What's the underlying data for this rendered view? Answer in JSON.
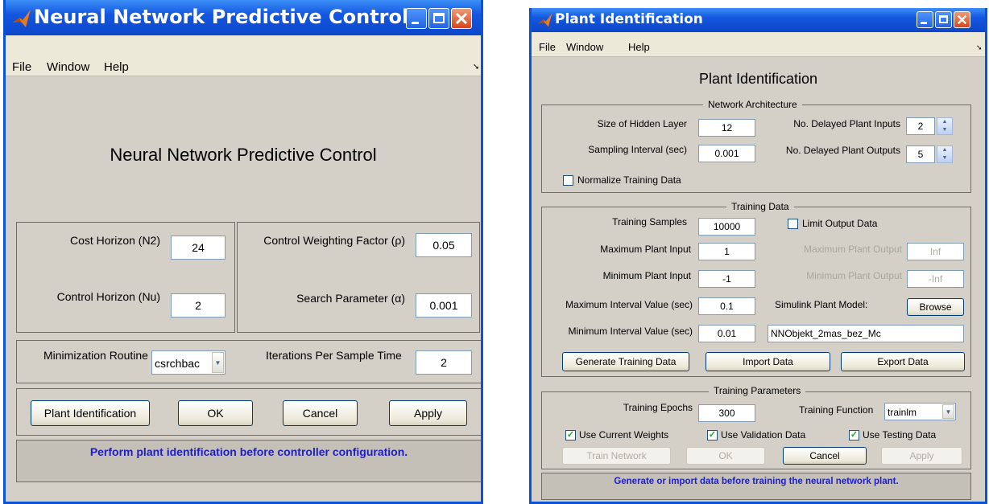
{
  "left_window": {
    "title": "Neural Network Predictive Control",
    "menu": [
      "File",
      "Window",
      "Help"
    ],
    "menu_arrow": "➘",
    "heading": "Neural Network Predictive Control",
    "cost_horizon": {
      "label": "Cost Horizon (N2)",
      "value": "24"
    },
    "control_horizon": {
      "label": "Control Horizon (Nu)",
      "value": "2"
    },
    "control_weighting": {
      "label": "Control Weighting Factor (ρ)",
      "value": "0.05"
    },
    "search_parameter": {
      "label": "Search Parameter (α)",
      "value": "0.001"
    },
    "minimization_routine": {
      "label": "Minimization Routine",
      "value": "csrchbac"
    },
    "iterations": {
      "label": "Iterations Per Sample Time",
      "value": "2"
    },
    "buttons": {
      "plant_identification": "Plant Identification",
      "ok": "OK",
      "cancel": "Cancel",
      "apply": "Apply"
    },
    "status": "Perform plant identification before controller configuration."
  },
  "right_window": {
    "title": "Plant Identification",
    "menu": [
      "File",
      "Window",
      "Help"
    ],
    "menu_arrow": "➘",
    "heading": "Plant Identification",
    "network_architecture": {
      "title": "Network Architecture",
      "hidden_layer": {
        "label": "Size of Hidden Layer",
        "value": "12"
      },
      "sampling_interval": {
        "label": "Sampling Interval (sec)",
        "value": "0.001"
      },
      "delayed_inputs": {
        "label": "No. Delayed Plant Inputs",
        "value": "2"
      },
      "delayed_outputs": {
        "label": "No. Delayed Plant Outputs",
        "value": "5"
      },
      "normalize": {
        "label": "Normalize Training Data",
        "checked": false
      }
    },
    "training_data": {
      "title": "Training Data",
      "samples": {
        "label": "Training Samples",
        "value": "10000"
      },
      "max_input": {
        "label": "Maximum Plant Input",
        "value": "1"
      },
      "min_input": {
        "label": "Minimum Plant Input",
        "value": "-1"
      },
      "max_interval": {
        "label": "Maximum Interval Value (sec)",
        "value": "0.1"
      },
      "min_interval": {
        "label": "Minimum Interval Value (sec)",
        "value": "0.01"
      },
      "limit_output": {
        "label": "Limit Output Data",
        "checked": false
      },
      "max_output": {
        "label": "Maximum Plant Output",
        "value": "Inf"
      },
      "min_output": {
        "label": "Minimum Plant Output",
        "value": "-Inf"
      },
      "simulink_model": {
        "label": "Simulink Plant Model:",
        "browse": "Browse",
        "value": "NNObjekt_2mas_bez_Mc"
      },
      "buttons": {
        "generate": "Generate Training Data",
        "import": "Import Data",
        "export": "Export Data"
      }
    },
    "training_parameters": {
      "title": "Training Parameters",
      "epochs": {
        "label": "Training Epochs",
        "value": "300"
      },
      "function": {
        "label": "Training Function",
        "value": "trainlm"
      },
      "use_current": {
        "label": "Use Current Weights",
        "checked": true
      },
      "use_validation": {
        "label": "Use Validation Data",
        "checked": true
      },
      "use_testing": {
        "label": "Use Testing Data",
        "checked": true
      },
      "buttons": {
        "train": "Train Network",
        "ok": "OK",
        "cancel": "Cancel",
        "apply": "Apply"
      }
    },
    "status": "Generate or import data before training the neural network plant."
  }
}
